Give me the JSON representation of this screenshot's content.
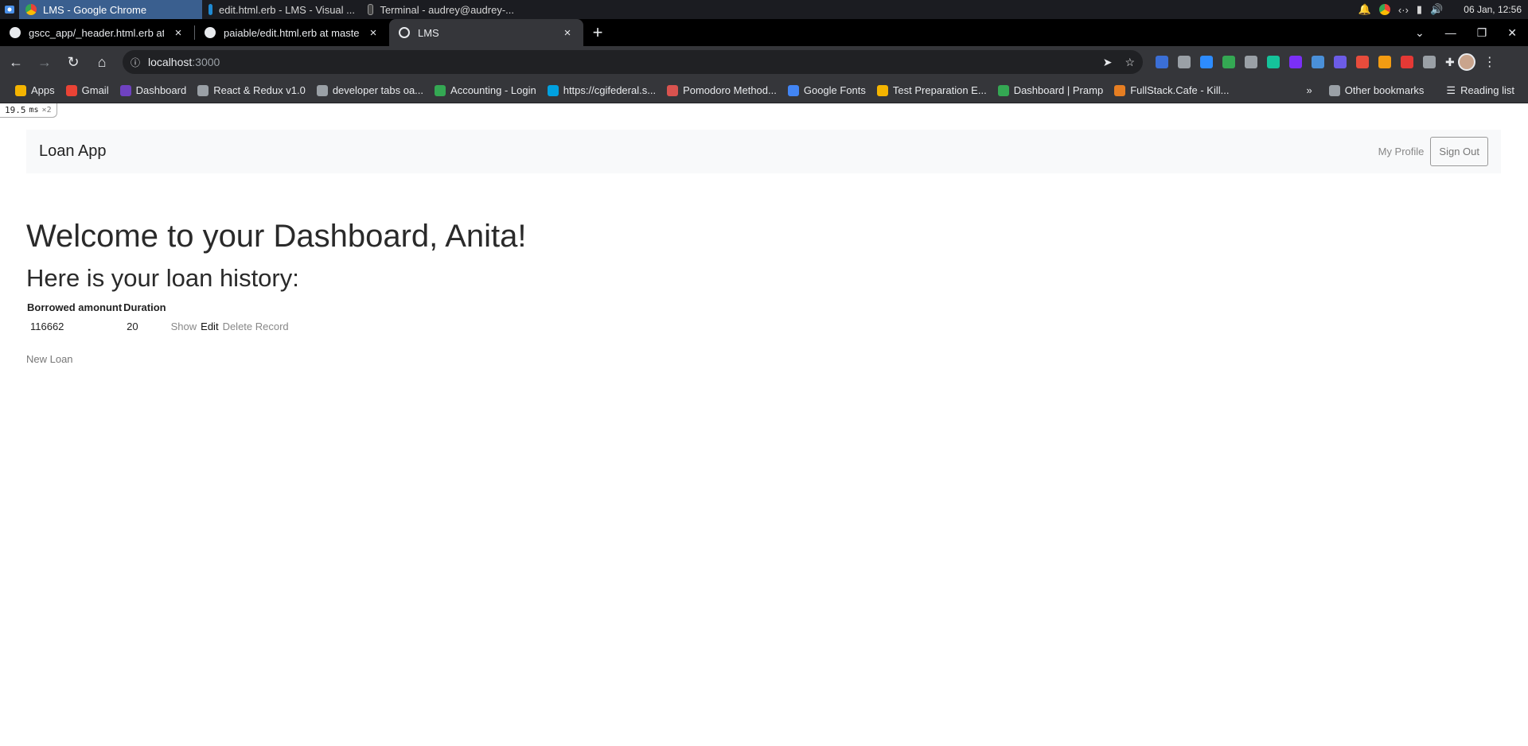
{
  "taskbar": {
    "tasks": [
      {
        "label": "LMS - Google Chrome"
      },
      {
        "label": "edit.html.erb - LMS - Visual ..."
      },
      {
        "label": "Terminal - audrey@audrey-..."
      }
    ],
    "clock": "06 Jan, 12:56"
  },
  "browser": {
    "tabs": [
      {
        "title": "gscc_app/_header.html.erb at p",
        "close": "×"
      },
      {
        "title": "paiable/edit.html.erb at master",
        "close": "×"
      },
      {
        "title": "LMS",
        "close": "×"
      }
    ],
    "new_tab": "+",
    "url_host": "localhost",
    "url_port": ":3000",
    "bookmarks": [
      {
        "label": "Apps",
        "color": "#f4b400"
      },
      {
        "label": "Gmail",
        "color": "#ea4335"
      },
      {
        "label": "Dashboard",
        "color": "#6f42c1"
      },
      {
        "label": "React & Redux v1.0",
        "color": "#9aa0a6"
      },
      {
        "label": "developer tabs oa...",
        "color": "#9aa0a6"
      },
      {
        "label": "Accounting - Login",
        "color": "#34a853"
      },
      {
        "label": "https://cgifederal.s...",
        "color": "#00a1e0"
      },
      {
        "label": "Pomodoro Method...",
        "color": "#d9534f"
      },
      {
        "label": "Google Fonts",
        "color": "#4285f4"
      },
      {
        "label": "Test Preparation E...",
        "color": "#f4b400"
      },
      {
        "label": "Dashboard | Pramp",
        "color": "#34a853"
      },
      {
        "label": "FullStack.Cafe - Kill...",
        "color": "#e67e22"
      }
    ],
    "more_bookmarks": "»",
    "other_bookmarks": "Other bookmarks",
    "reading_list": "Reading list",
    "extension_colors": [
      "#3b6fd6",
      "#9aa0a6",
      "#2d8cff",
      "#34a853",
      "#9aa0a6",
      "#15c39a",
      "#7b2ff7",
      "#4a90d9",
      "#6c5ce7",
      "#e74c3c",
      "#f39c12",
      "#e53935",
      "#9aa0a6"
    ]
  },
  "perf_badge": {
    "value": "19.5",
    "unit": "ms",
    "mult": "×2"
  },
  "app": {
    "brand": "Loan App",
    "my_profile": "My Profile",
    "sign_out": "Sign Out",
    "welcome": "Welcome to your Dashboard, Anita!",
    "history_heading": "Here is your loan history:",
    "table": {
      "headers": [
        "Borrowed amonunt",
        "Duration"
      ],
      "rows": [
        {
          "amount": "116662",
          "duration": "20",
          "show": "Show",
          "edit": "Edit",
          "delete": "Delete Record"
        }
      ]
    },
    "new_loan": "New Loan"
  }
}
